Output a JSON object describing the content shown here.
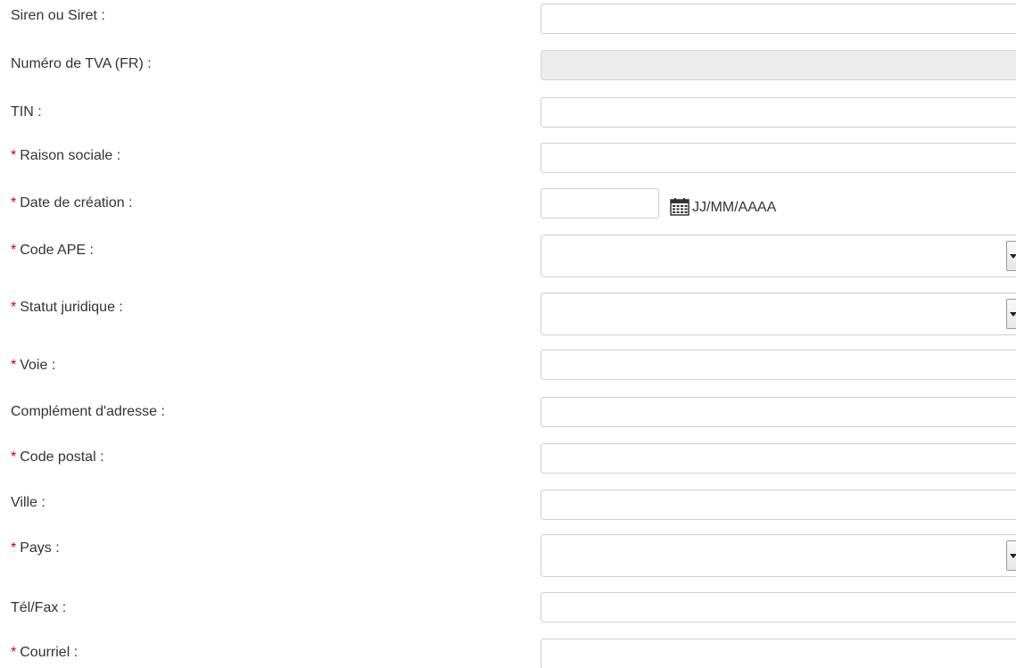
{
  "form": {
    "fields": [
      {
        "label": "Siren ou Siret :",
        "required": false,
        "value": ""
      },
      {
        "label": "Numéro de TVA (FR) :",
        "required": false,
        "value": "",
        "disabled": true
      },
      {
        "label": "TIN :",
        "required": false,
        "value": ""
      },
      {
        "label": "Raison sociale :",
        "required": true,
        "value": ""
      },
      {
        "label": "Date de création :",
        "required": true,
        "value": "",
        "format_hint": "JJ/MM/AAAA",
        "icon": "calendar-icon"
      },
      {
        "label": "Code APE :",
        "required": true,
        "selected": ""
      },
      {
        "label": "Statut juridique :",
        "required": true,
        "selected": ""
      },
      {
        "label": "Voie :",
        "required": true,
        "value": ""
      },
      {
        "label": "Complément d'adresse :",
        "required": false,
        "value": ""
      },
      {
        "label": "Code postal :",
        "required": true,
        "value": ""
      },
      {
        "label": "Ville :",
        "required": false,
        "value": ""
      },
      {
        "label": "Pays :",
        "required": true,
        "selected": ""
      },
      {
        "label": "Tél/Fax :",
        "required": false,
        "value": ""
      },
      {
        "label": "Courriel :",
        "required": true,
        "value": ""
      }
    ],
    "required_marker": "*"
  },
  "colors": {
    "required_marker": "#cc0000",
    "label_text": "#333333",
    "field_border": "#cfcfcf",
    "disabled_background": "#ececec"
  }
}
